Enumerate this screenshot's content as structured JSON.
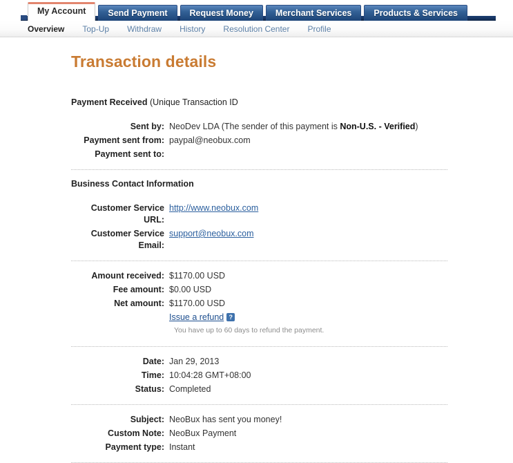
{
  "nav": {
    "tabs": [
      {
        "label": "My Account",
        "active": true
      },
      {
        "label": "Send Payment",
        "active": false
      },
      {
        "label": "Request Money",
        "active": false
      },
      {
        "label": "Merchant Services",
        "active": false
      },
      {
        "label": "Products & Services",
        "active": false
      }
    ],
    "subnav": [
      {
        "label": "Overview",
        "active": true
      },
      {
        "label": "Top-Up",
        "active": false
      },
      {
        "label": "Withdraw",
        "active": false
      },
      {
        "label": "History",
        "active": false
      },
      {
        "label": "Resolution Center",
        "active": false
      },
      {
        "label": "Profile",
        "active": false
      }
    ]
  },
  "page": {
    "title": "Transaction details",
    "title_color": "#c97b32"
  },
  "payment_received": {
    "heading_bold": "Payment Received",
    "heading_rest": " (Unique Transaction ID",
    "rows": [
      {
        "label": "Sent by:",
        "value": "NeoDev LDA (The sender of this payment is ",
        "value_bold": "Non-U.S. - Verified",
        "value_tail": ")"
      },
      {
        "label": "Payment sent from:",
        "value": "paypal@neobux.com"
      },
      {
        "label": "Payment sent to:",
        "value": ""
      }
    ]
  },
  "business_contact": {
    "heading": "Business Contact Information",
    "rows": [
      {
        "label": "Customer Service URL:",
        "value": "http://www.neobux.com",
        "is_link": true
      },
      {
        "label": "Customer Service Email:",
        "value": "support@neobux.com",
        "is_link": true
      }
    ]
  },
  "amounts": {
    "rows": [
      {
        "label": "Amount received:",
        "value": "$1170.00 USD"
      },
      {
        "label": "Fee amount:",
        "value": "$0.00 USD"
      },
      {
        "label": "Net amount:",
        "value": "$1170.00 USD"
      }
    ],
    "refund_link": "Issue a refund",
    "help_icon_glyph": "?",
    "help_icon_name": "question-mark-icon",
    "refund_hint": "You have up to 60 days to refund the payment."
  },
  "timing": {
    "rows": [
      {
        "label": "Date:",
        "value": "Jan 29, 2013"
      },
      {
        "label": "Time:",
        "value": "10:04:28 GMT+08:00"
      },
      {
        "label": "Status:",
        "value": "Completed"
      }
    ]
  },
  "details": {
    "rows": [
      {
        "label": "Subject:",
        "value": "NeoBux has sent you money!"
      },
      {
        "label": "Custom Note:",
        "value": "NeoBux Payment"
      },
      {
        "label": "Payment type:",
        "value": "Instant"
      }
    ]
  }
}
